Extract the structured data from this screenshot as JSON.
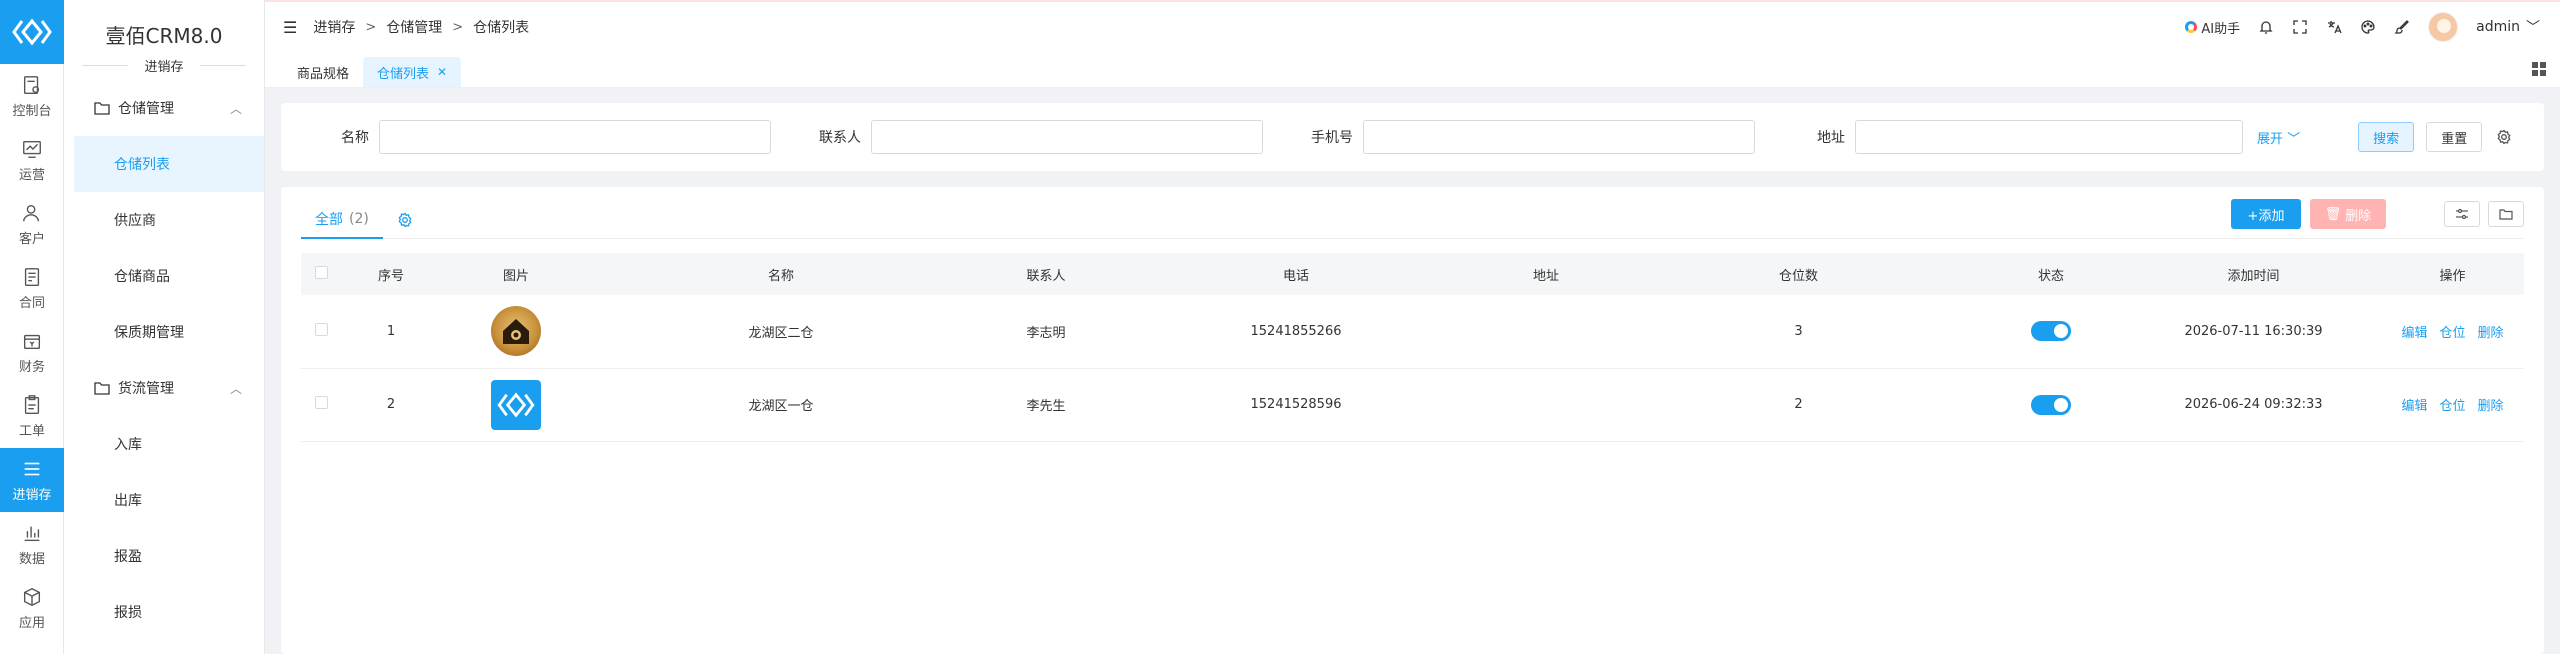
{
  "app": {
    "title": "壹佰CRM8.0",
    "subtitle": "进销存"
  },
  "rail": [
    {
      "label": "控制台",
      "icon": "dashboard-icon"
    },
    {
      "label": "运营",
      "icon": "operation-icon"
    },
    {
      "label": "客户",
      "icon": "customer-icon"
    },
    {
      "label": "合同",
      "icon": "contract-icon"
    },
    {
      "label": "财务",
      "icon": "finance-icon"
    },
    {
      "label": "工单",
      "icon": "workorder-icon"
    },
    {
      "label": "进销存",
      "icon": "inventory-icon",
      "active": true
    },
    {
      "label": "数据",
      "icon": "data-icon"
    },
    {
      "label": "应用",
      "icon": "apps-icon"
    }
  ],
  "sidebar": {
    "groups": [
      {
        "label": "仓储管理",
        "items": [
          "仓储列表",
          "供应商",
          "仓储商品",
          "保质期管理"
        ]
      },
      {
        "label": "货流管理",
        "items": [
          "入库",
          "出库",
          "报盈",
          "报损"
        ]
      }
    ]
  },
  "header": {
    "breadcrumb": [
      "进销存",
      "仓储管理",
      "仓储列表"
    ],
    "sep": ">",
    "ai_label": "AI助手",
    "user": "admin"
  },
  "page_tabs": [
    "商品规格",
    "仓储列表"
  ],
  "search": {
    "fields": [
      {
        "label": "名称",
        "value": ""
      },
      {
        "label": "联系人",
        "value": ""
      },
      {
        "label": "手机号",
        "value": ""
      },
      {
        "label": "地址",
        "value": ""
      }
    ],
    "expand": "展开",
    "search_btn": "搜索",
    "reset_btn": "重置"
  },
  "list": {
    "tab_label": "全部",
    "tab_count": "(2)",
    "add_btn": "+添加",
    "delete_btn": "删除",
    "columns": [
      "序号",
      "图片",
      "名称",
      "联系人",
      "电话",
      "地址",
      "仓位数",
      "状态",
      "添加时间",
      "操作"
    ],
    "rows": [
      {
        "no": "1",
        "img": "warehouse-logo",
        "name": "龙湖区二仓",
        "contact": "李志明",
        "phone": "15241855266",
        "address": "",
        "slots": "3",
        "enabled": true,
        "time": "2026-07-11 16:30:39"
      },
      {
        "no": "2",
        "img": "brand-logo",
        "name": "龙湖区一仓",
        "contact": "李先生",
        "phone": "15241528596",
        "address": "",
        "slots": "2",
        "enabled": true,
        "time": "2026-06-24 09:32:33"
      }
    ],
    "ops": [
      "编辑",
      "仓位",
      "删除"
    ]
  },
  "colors": {
    "primary": "#1a9ff0",
    "danger_light": "#ffb3b3"
  }
}
